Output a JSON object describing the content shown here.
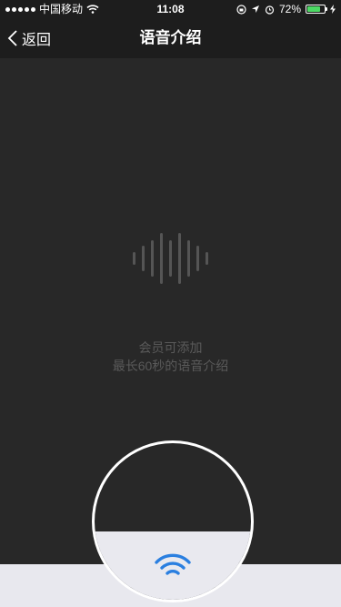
{
  "status_bar": {
    "carrier": "中国移动",
    "time": "11:08",
    "battery": "72%",
    "battery_level": 0.72,
    "icons": [
      "signal-dots",
      "wifi-icon",
      "orientation-lock-icon",
      "location-icon",
      "alarm-icon",
      "battery-icon",
      "charging-icon"
    ]
  },
  "nav": {
    "back_label": "返回",
    "title": "语音介绍"
  },
  "main": {
    "hint_line1": "会员可添加",
    "hint_line2": "最长60秒的语音介绍",
    "wave_icon": "voice-wave-icon"
  },
  "bottom": {
    "record_icon": "voice-record-icon",
    "accent_color": "#2a7fe0"
  },
  "colors": {
    "background": "#282828",
    "bar": "#1d1d1d",
    "hint_text": "#5a5a5a",
    "bottom_bar": "#e8e8ee"
  }
}
